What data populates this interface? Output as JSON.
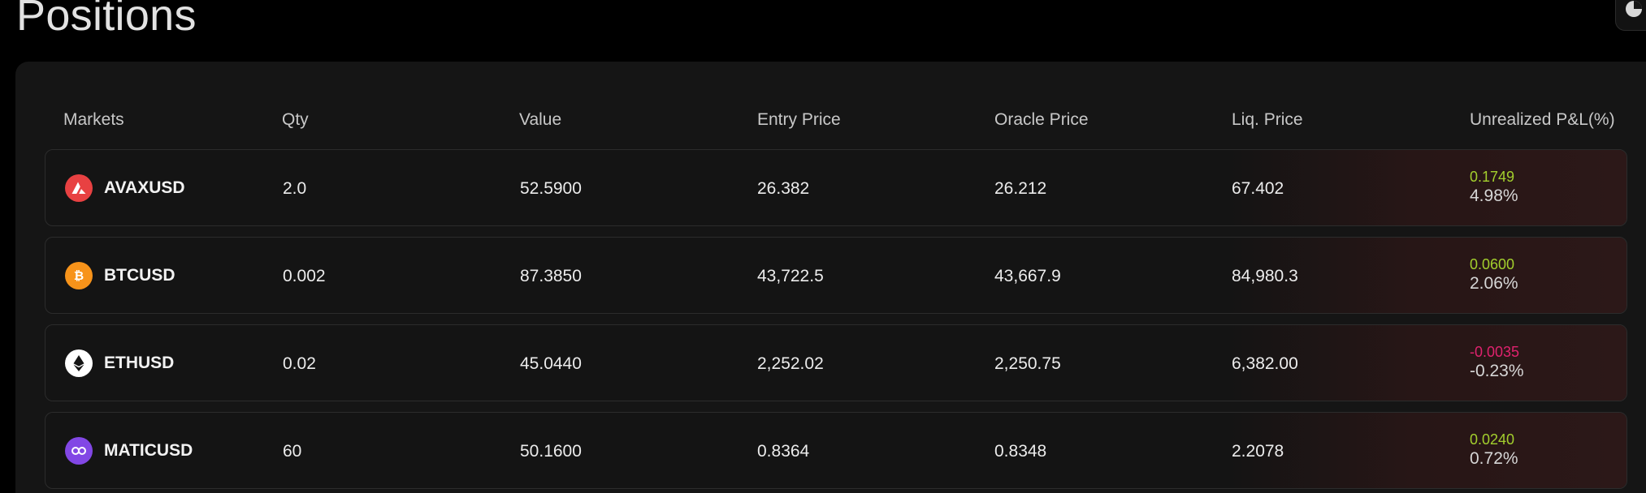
{
  "page": {
    "title": "Positions"
  },
  "colors": {
    "background": "#000000",
    "panel": "#151515",
    "positive": "#a3cf2d",
    "negative": "#e0226e",
    "avax": "#e84142",
    "btc": "#f7931a",
    "eth": "#ffffff",
    "matic": "#8247e5"
  },
  "table": {
    "headers": {
      "markets": "Markets",
      "qty": "Qty",
      "value": "Value",
      "entry_price": "Entry Price",
      "oracle_price": "Oracle Price",
      "liq_price": "Liq. Price",
      "unrealized_pnl": "Unrealized P&L(%)"
    },
    "rows": [
      {
        "market": "AVAXUSD",
        "icon": "avax-icon",
        "qty": "2.0",
        "value": "52.5900",
        "entry_price": "26.382",
        "oracle_price": "26.212",
        "liq_price": "67.402",
        "pnl_value": "0.1749",
        "pnl_pct": "4.98%",
        "pnl_sign": "positive"
      },
      {
        "market": "BTCUSD",
        "icon": "btc-icon",
        "qty": "0.002",
        "value": "87.3850",
        "entry_price": "43,722.5",
        "oracle_price": "43,667.9",
        "liq_price": "84,980.3",
        "pnl_value": "0.0600",
        "pnl_pct": "2.06%",
        "pnl_sign": "positive"
      },
      {
        "market": "ETHUSD",
        "icon": "eth-icon",
        "qty": "0.02",
        "value": "45.0440",
        "entry_price": "2,252.02",
        "oracle_price": "2,250.75",
        "liq_price": "6,382.00",
        "pnl_value": "-0.0035",
        "pnl_pct": "-0.23%",
        "pnl_sign": "negative"
      },
      {
        "market": "MATICUSD",
        "icon": "matic-icon",
        "qty": "60",
        "value": "50.1600",
        "entry_price": "0.8364",
        "oracle_price": "0.8348",
        "liq_price": "2.2078",
        "pnl_value": "0.0240",
        "pnl_pct": "0.72%",
        "pnl_sign": "positive"
      }
    ]
  }
}
